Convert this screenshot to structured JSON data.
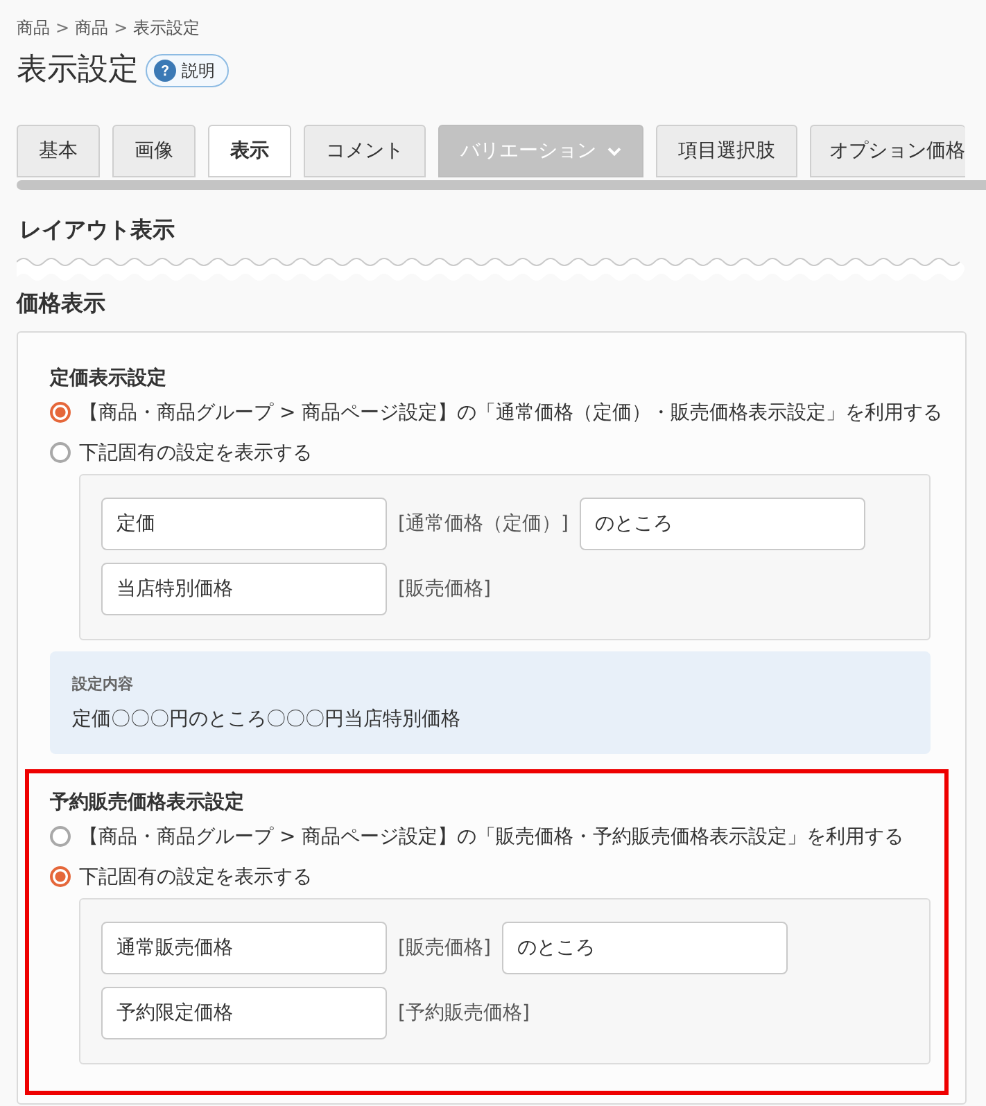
{
  "breadcrumb": [
    {
      "kind": "link",
      "text": "商品"
    },
    {
      "kind": "separator",
      "text": ">"
    },
    {
      "kind": "link",
      "text": "商品"
    },
    {
      "kind": "separator",
      "text": ">"
    },
    {
      "kind": "current",
      "text": "表示設定"
    }
  ],
  "page": {
    "title": "表示設定",
    "help_button": "説明"
  },
  "tabs": [
    {
      "label": "基本",
      "selected": false,
      "kind": "plain"
    },
    {
      "label": "画像",
      "selected": false,
      "kind": "plain"
    },
    {
      "label": "表示",
      "selected": true,
      "kind": "plain"
    },
    {
      "label": "コメント",
      "selected": false,
      "kind": "plain"
    },
    {
      "label": "バリエーション",
      "selected": false,
      "kind": "dropdown"
    },
    {
      "label": "項目選択肢",
      "selected": false,
      "kind": "plain"
    },
    {
      "label": "オプション価格",
      "selected": false,
      "kind": "plain"
    }
  ],
  "layout_section": {
    "title": "レイアウト表示",
    "collapsed": true
  },
  "price_section": {
    "title": "価格表示",
    "groups": [
      {
        "title": "定価表示設定",
        "highlighted": false,
        "options": [
          {
            "label": "【商品・商品グループ > 商品ページ設定】の「通常価格（定価）・販売価格表示設定」を利用する",
            "selected": true
          },
          {
            "label": "下記固有の設定を表示する",
            "selected": false
          }
        ],
        "rows": [
          {
            "items": [
              {
                "kind": "input",
                "value": "定価"
              },
              {
                "kind": "label",
                "text": "[通常価格（定価）]"
              },
              {
                "kind": "input",
                "value": "のところ"
              }
            ]
          },
          {
            "items": [
              {
                "kind": "input",
                "value": "当店特別価格"
              },
              {
                "kind": "label",
                "text": "[販売価格]"
              }
            ]
          }
        ],
        "summary": {
          "title": "設定内容",
          "text": "定価〇〇〇円のところ〇〇〇円当店特別価格"
        }
      },
      {
        "title": "予約販売価格表示設定",
        "highlighted": true,
        "options": [
          {
            "label": "【商品・商品グループ > 商品ページ設定】の「販売価格・予約販売価格表示設定」を利用する",
            "selected": false
          },
          {
            "label": "下記固有の設定を表示する",
            "selected": true
          }
        ],
        "rows": [
          {
            "items": [
              {
                "kind": "input",
                "value": "通常販売価格"
              },
              {
                "kind": "label",
                "text": "[販売価格]"
              },
              {
                "kind": "input",
                "value": "のところ"
              }
            ]
          },
          {
            "items": [
              {
                "kind": "input",
                "value": "予約限定価格"
              },
              {
                "kind": "label",
                "text": "[予約販売価格]"
              }
            ]
          }
        ]
      }
    ]
  }
}
